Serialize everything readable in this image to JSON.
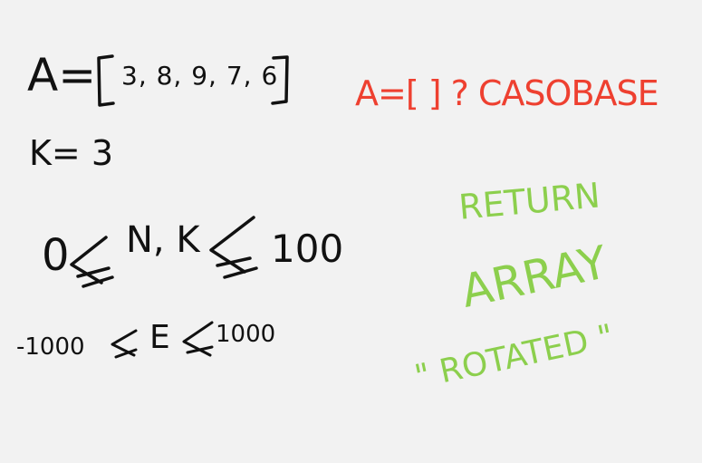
{
  "colors": {
    "background": "#f2f2f2",
    "black_ink": "#111111",
    "red_ink": "#ee4030",
    "green_ink": "#8ccf4d"
  },
  "notes": {
    "array_label": "A=",
    "array_values": "3, 8, 9, 7, 6",
    "k_line": "K= 3",
    "constraint_nk_zero": "0",
    "constraint_nk_vars": "N, K",
    "constraint_nk_max": "100",
    "constraint_e_min": "-1000",
    "constraint_e_var": "E",
    "constraint_e_max": "1000",
    "base_case": "A=[ ] ? CASOBASE",
    "return_line1": "RETURN",
    "return_line2": "ARRAY",
    "return_line3": "\" ROTATED \""
  }
}
